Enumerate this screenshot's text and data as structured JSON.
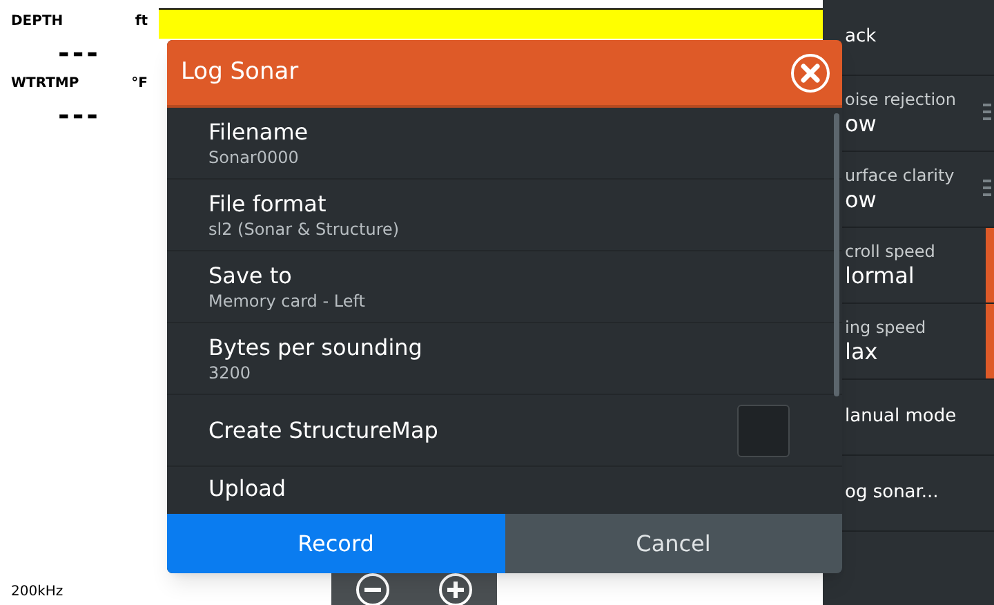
{
  "readouts": [
    {
      "label": "DEPTH",
      "unit": "ft",
      "value": "---"
    },
    {
      "label": "WTRTMP",
      "unit": "°F",
      "value": "---"
    }
  ],
  "frequency": "200kHz",
  "menu": [
    {
      "label": "ack"
    },
    {
      "label": "oise rejection",
      "value": "ow",
      "adjustable": true,
      "highlighted": false
    },
    {
      "label": "urface clarity",
      "value": "ow",
      "adjustable": true,
      "highlighted": false
    },
    {
      "label": "croll speed",
      "value": "lormal",
      "adjustable": false,
      "highlighted": true
    },
    {
      "label": "ing speed",
      "value": "lax",
      "adjustable": false,
      "highlighted": true
    },
    {
      "label": "lanual mode"
    },
    {
      "label": "og sonar..."
    }
  ],
  "dialog": {
    "title": "Log Sonar",
    "items": [
      {
        "kind": "setting",
        "label": "Filename",
        "value": "Sonar0000"
      },
      {
        "kind": "setting",
        "label": "File format",
        "value": "sl2 (Sonar & Structure)"
      },
      {
        "kind": "setting",
        "label": "Save to",
        "value": "Memory card - Left"
      },
      {
        "kind": "setting",
        "label": "Bytes per sounding",
        "value": "3200"
      },
      {
        "kind": "checkbox",
        "label": "Create StructureMap",
        "checked": false
      },
      {
        "kind": "action",
        "label": "Upload"
      }
    ],
    "buttons": [
      {
        "label": "Record",
        "primary": true
      },
      {
        "label": "Cancel",
        "primary": false
      }
    ]
  }
}
